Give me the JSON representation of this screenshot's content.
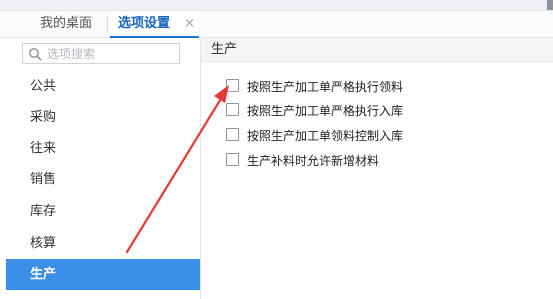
{
  "tabs": [
    {
      "label": "我的桌面"
    },
    {
      "label": "选项设置",
      "close_icon": "×"
    }
  ],
  "search": {
    "placeholder": "选项搜索"
  },
  "sidebar": {
    "items": [
      {
        "label": "公共"
      },
      {
        "label": "采购"
      },
      {
        "label": "往来"
      },
      {
        "label": "销售"
      },
      {
        "label": "库存"
      },
      {
        "label": "核算"
      },
      {
        "label": "生产",
        "active": true
      }
    ]
  },
  "panel": {
    "title": "生产",
    "options": [
      {
        "label": "按照生产加工单严格执行领料",
        "checked": false
      },
      {
        "label": "按照生产加工单严格执行入库",
        "checked": false
      },
      {
        "label": "按照生产加工单领料控制入库",
        "checked": false
      },
      {
        "label": "生产补料时允许新增材料",
        "checked": false
      }
    ]
  },
  "colors": {
    "accent": "#3a8ee6",
    "tab_active_text": "#1565c0",
    "annotation_arrow": "#e53935"
  },
  "icons": {
    "search": "search-icon",
    "close": "close-icon",
    "checkbox": "checkbox-icon"
  }
}
